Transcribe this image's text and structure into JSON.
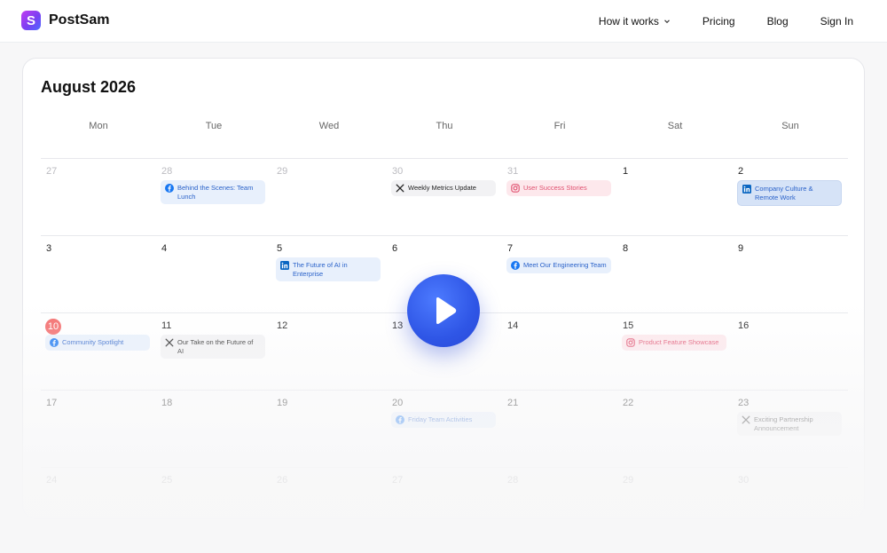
{
  "brand": {
    "logo_letter": "S",
    "name": "PostSam"
  },
  "nav": [
    {
      "label": "How it works",
      "dropdown": true
    },
    {
      "label": "Pricing"
    },
    {
      "label": "Blog"
    },
    {
      "label": "Sign In"
    }
  ],
  "calendar": {
    "month_title": "August 2026",
    "weekdays": [
      "Mon",
      "Tue",
      "Wed",
      "Thu",
      "Fri",
      "Sat",
      "Sun"
    ],
    "weeks": [
      [
        {
          "day": "27",
          "muted": true
        },
        {
          "day": "28",
          "muted": true,
          "event": {
            "platform": "facebook",
            "text": "Behind the Scenes: Team Lunch",
            "style": "blue"
          }
        },
        {
          "day": "29",
          "muted": true
        },
        {
          "day": "30",
          "muted": true,
          "event": {
            "platform": "x",
            "text": "Weekly Metrics Update",
            "style": "gray"
          }
        },
        {
          "day": "31",
          "muted": true,
          "event": {
            "platform": "instagram",
            "text": "User Success Stories",
            "style": "pink"
          }
        },
        {
          "day": "1"
        },
        {
          "day": "2",
          "event": {
            "platform": "linkedin",
            "text": "Company Culture & Remote Work",
            "style": "blue-strong"
          }
        }
      ],
      [
        {
          "day": "3"
        },
        {
          "day": "4"
        },
        {
          "day": "5",
          "event": {
            "platform": "linkedin",
            "text": "The Future of AI in Enterprise",
            "style": "blue"
          }
        },
        {
          "day": "6"
        },
        {
          "day": "7",
          "event": {
            "platform": "facebook",
            "text": "Meet Our Engineering Team",
            "style": "blue"
          }
        },
        {
          "day": "8"
        },
        {
          "day": "9"
        }
      ],
      [
        {
          "day": "10",
          "today": true,
          "event": {
            "platform": "facebook",
            "text": "Community Spotlight",
            "style": "blue"
          }
        },
        {
          "day": "11",
          "event": {
            "platform": "x",
            "text": "Our Take on the Future of AI",
            "style": "gray"
          }
        },
        {
          "day": "12"
        },
        {
          "day": "13"
        },
        {
          "day": "14"
        },
        {
          "day": "15",
          "event": {
            "platform": "instagram",
            "text": "Product Feature Showcase",
            "style": "pink"
          }
        },
        {
          "day": "16"
        }
      ],
      [
        {
          "day": "17"
        },
        {
          "day": "18"
        },
        {
          "day": "19"
        },
        {
          "day": "20",
          "event": {
            "platform": "facebook",
            "text": "Friday Team Activities",
            "style": "blue"
          }
        },
        {
          "day": "21"
        },
        {
          "day": "22"
        },
        {
          "day": "23",
          "event": {
            "platform": "x",
            "text": "Exciting Partnership Announcement",
            "style": "gray"
          }
        }
      ],
      [
        {
          "day": "24"
        },
        {
          "day": "25"
        },
        {
          "day": "26"
        },
        {
          "day": "27"
        },
        {
          "day": "28"
        },
        {
          "day": "29"
        },
        {
          "day": "30"
        }
      ]
    ]
  },
  "play_button": {
    "icon": "play-icon"
  },
  "colors": {
    "accent": "#2f56e6",
    "today": "#f46a6a",
    "facebook": "#1877f2",
    "linkedin": "#0a66c2",
    "instagram": "#e0506f"
  }
}
